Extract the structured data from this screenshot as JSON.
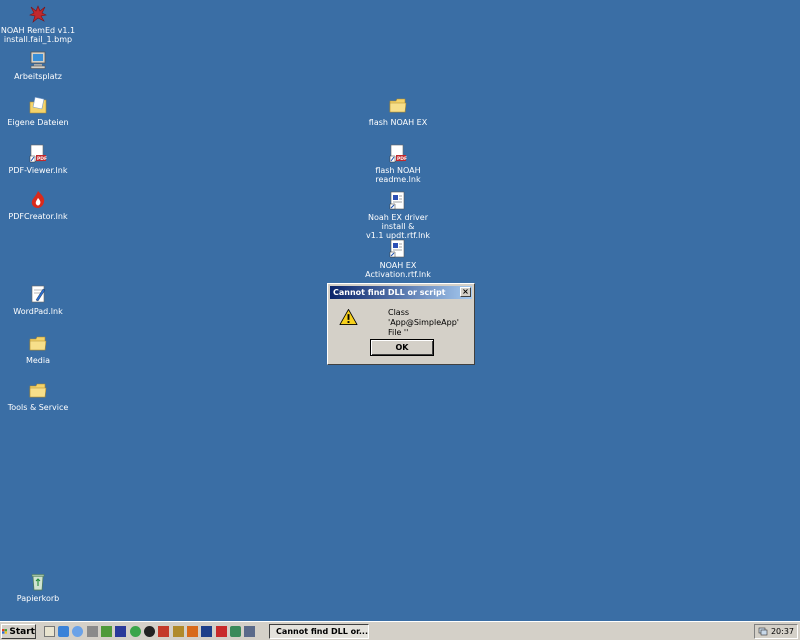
{
  "desktop": {
    "icons": [
      {
        "label": "NOAH RemEd v1.1\ninstall.fail_1.bmp",
        "icon": "red-puzzle-icon"
      },
      {
        "label": "Arbeitsplatz",
        "icon": "computer-icon"
      },
      {
        "label": "Eigene Dateien",
        "icon": "documents-folder-icon"
      },
      {
        "label": "PDF-Viewer.lnk",
        "icon": "pdf-icon"
      },
      {
        "label": "PDFCreator.lnk",
        "icon": "pdfcreator-icon"
      },
      {
        "label": "WordPad.lnk",
        "icon": "wordpad-icon"
      },
      {
        "label": "Media",
        "icon": "folder-icon"
      },
      {
        "label": "Tools & Service",
        "icon": "folder-icon"
      },
      {
        "label": "Papierkorb",
        "icon": "recycle-bin-icon"
      },
      {
        "label": "flash NOAH EX",
        "icon": "folder-icon"
      },
      {
        "label": "flash NOAH readme.lnk",
        "icon": "pdf-icon"
      },
      {
        "label": "Noah EX driver install &\nv1.1 updt.rtf.lnk",
        "icon": "rtf-document-icon"
      },
      {
        "label": "NOAH EX\nActivation.rtf.lnk",
        "icon": "rtf-document-icon"
      }
    ]
  },
  "dialog": {
    "title": "Cannot find DLL or script",
    "close": "×",
    "message_line1": "Class 'App@SimpleApp'",
    "message_line2": "File ''",
    "ok_label": "OK"
  },
  "taskbar": {
    "start_label": "Start",
    "task_label": "Cannot find DLL or...",
    "clock": "20:37"
  },
  "colors": {
    "desktop": "#3a6ea5",
    "titlebar": "#0a246a",
    "folder": "#f3d36b"
  }
}
